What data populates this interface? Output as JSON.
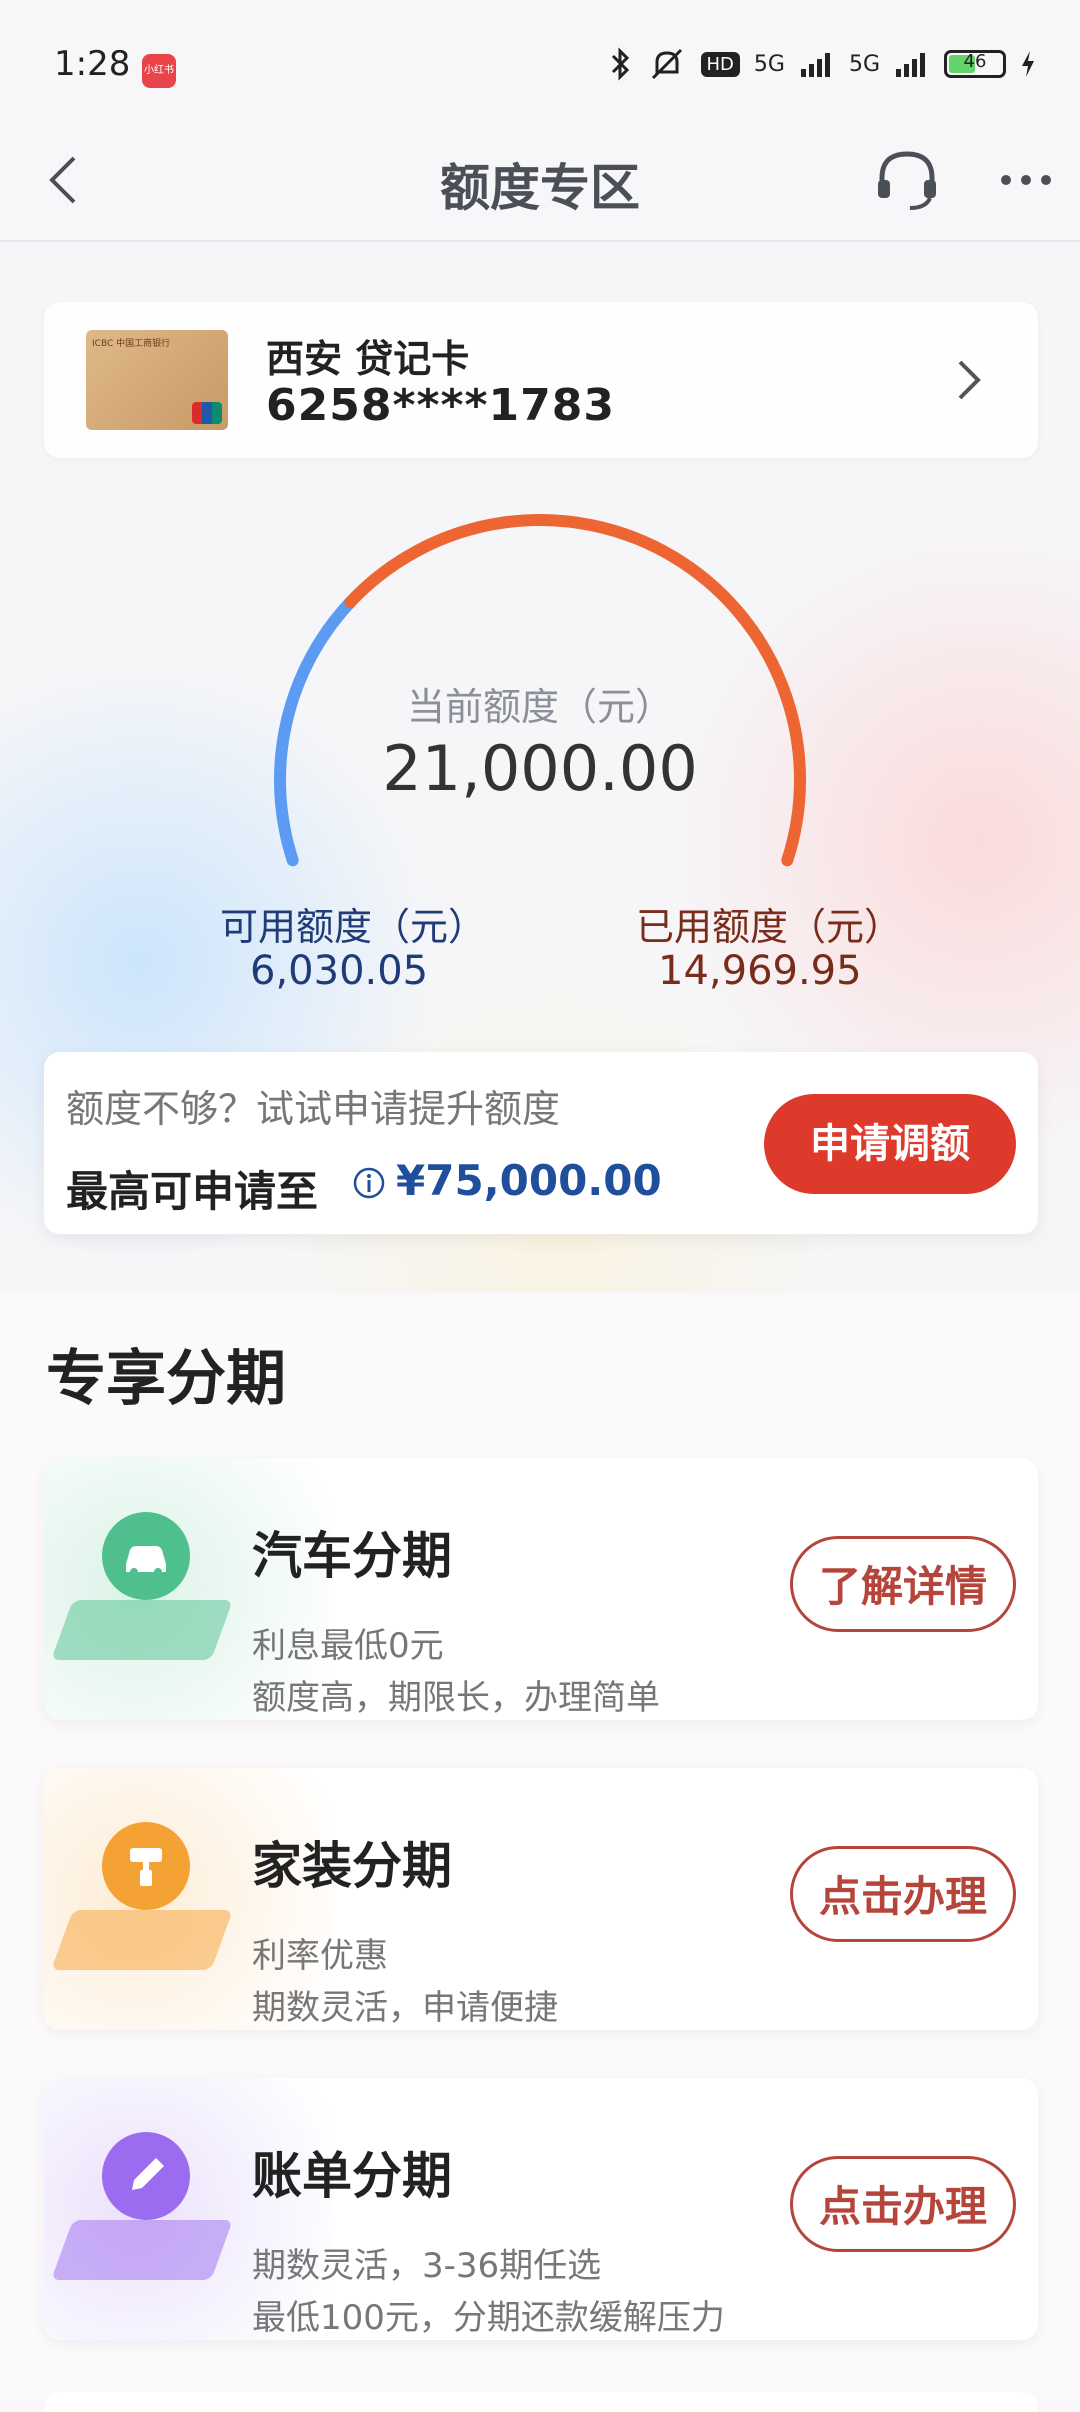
{
  "status_bar": {
    "time": "1:28",
    "app_badge": "小红书",
    "network1": "5G",
    "network2": "5G",
    "hd_label": "HD",
    "battery": "46"
  },
  "header": {
    "title": "额度专区"
  },
  "card": {
    "name": "西安 贷记卡",
    "number": "6258****1783",
    "bank_logo": "ICBC 中国工商银行"
  },
  "gauge": {
    "label": "当前额度（元）",
    "value": "21,000.00",
    "available_label": "可用额度（元）",
    "available_value": "6,030.05",
    "used_label": "已用额度（元）",
    "used_value": "14,969.95",
    "used_fraction": 0.7128,
    "colors": {
      "available": "#5b9cf2",
      "used": "#ec6532"
    }
  },
  "raise": {
    "hint": "额度不够？试试申请提升额度",
    "max_label": "最高可申请至",
    "max_amount": "¥75,000.00",
    "button": "申请调额"
  },
  "installments": {
    "section_title": "专享分期",
    "items": [
      {
        "name": "汽车分期",
        "desc1": "利息最低0元",
        "desc2": "额度高，期限长，办理简单",
        "button": "了解详情",
        "icon": "car-icon",
        "color": "#4fc08d"
      },
      {
        "name": "家装分期",
        "desc1": "利率优惠",
        "desc2": "期数灵活，申请便捷",
        "button": "点击办理",
        "icon": "paint-roller-icon",
        "color": "#f5a234"
      },
      {
        "name": "账单分期",
        "desc1": "期数灵活，3-36期任选",
        "desc2": "最低100元，分期还款缓解压力",
        "button": "点击办理",
        "icon": "pencil-icon",
        "color": "#9b6cf0"
      }
    ]
  }
}
